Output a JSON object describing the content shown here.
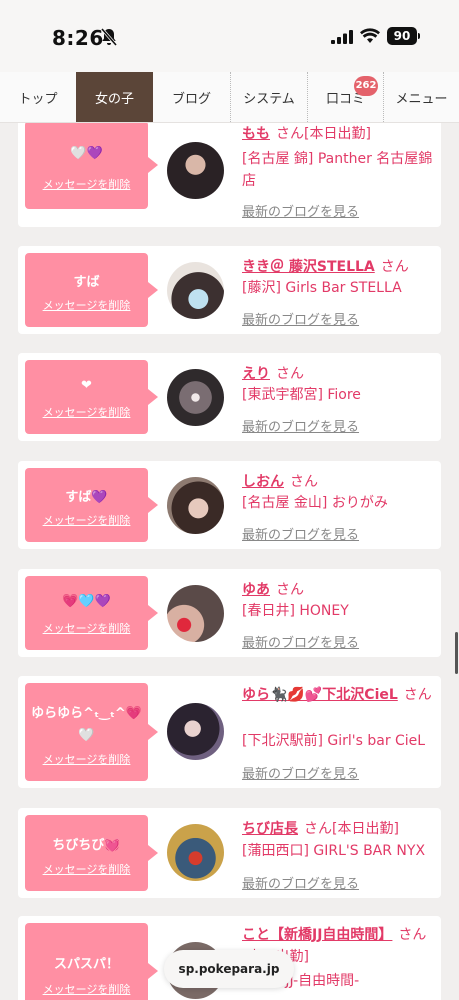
{
  "status": {
    "time": "8:26",
    "battery": "90"
  },
  "nav": {
    "tabs": [
      "トップ",
      "女の子",
      "ブログ",
      "システム",
      "口コミ",
      "メニュー"
    ],
    "badge": "262"
  },
  "messages": [
    {
      "bubble": "🤍💜",
      "delete": "メッセージを削除",
      "name": "もも",
      "san": "さん",
      "status": "[本日出勤]",
      "shop": "[名古屋 錦] Panther 名古屋錦店",
      "blog": "最新のブログを見る"
    },
    {
      "bubble": "すば",
      "delete": "メッセージを削除",
      "name": "きき＠ 藤沢STELLA",
      "san": "さん",
      "status": "",
      "shop": "[藤沢] Girls Bar STELLA",
      "blog": "最新のブログを見る"
    },
    {
      "bubble": "❤",
      "delete": "メッセージを削除",
      "name": "えり",
      "san": "さん",
      "status": "",
      "shop": "[東武宇都宮] Fiore",
      "blog": "最新のブログを見る"
    },
    {
      "bubble": "すば💜",
      "delete": "メッセージを削除",
      "name": "しおん",
      "san": "さん",
      "status": "",
      "shop": "[名古屋 金山] おりがみ",
      "blog": "最新のブログを見る"
    },
    {
      "bubble": "💗🩵💜",
      "delete": "メッセージを削除",
      "name": "ゆあ",
      "san": "さん",
      "status": "",
      "shop": "[春日井] HONEY",
      "blog": "最新のブログを見る"
    },
    {
      "bubble": "ゆらゆら^ₜ‿ₜ^💗🤍",
      "delete": "メッセージを削除",
      "name": "ゆら🐈‍⬛💋💕下北沢CieL",
      "san": "さん",
      "status": "",
      "shop": "[下北沢駅前] Girl's bar CieL",
      "blog": "最新のブログを見る"
    },
    {
      "bubble": "ちびちび💓",
      "delete": "メッセージを削除",
      "name": "ちび店長",
      "san": "さん",
      "status": "[本日出勤]",
      "shop": "[蒲田西口] GIRL'S BAR NYX",
      "blog": "最新のブログを見る"
    },
    {
      "bubble": "スパスパ！",
      "delete": "メッセージを削除",
      "name": "こと【新橋JJ自由時間】",
      "san": "さん",
      "status": "[本日出勤]",
      "shop": "[新橋] JJ-自由時間-",
      "blog": ""
    }
  ],
  "url": "sp.pokepara.jp"
}
